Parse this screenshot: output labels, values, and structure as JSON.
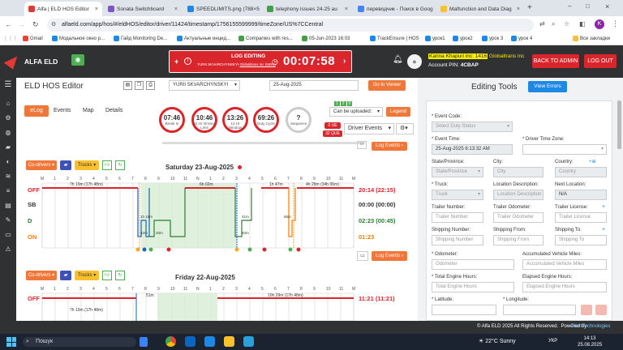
{
  "browser": {
    "tabs": [
      {
        "title": "Alfa | ELD HOS Editor",
        "color": "#e53935"
      },
      {
        "title": "Sonata Switchboard",
        "color": "#7e57c2"
      },
      {
        "title": "SPEEDLIMITS.png (788×5",
        "color": "#1e88e5"
      },
      {
        "title": "telephony issues 24-25 au",
        "color": "#43a047"
      },
      {
        "title": "переводчик - Поиск в Goog",
        "color": "#4285f4"
      },
      {
        "title": "Malfunction and Data Diag",
        "color": "#fbc02d"
      }
    ],
    "url": "alfaeld.com/app/hos/#/eldHOS/editor/driver/11424/timestamp/1756155599999/timeZone/US%7CCentral",
    "bookmarks": [
      "Gmail",
      "Модальное окно р...",
      "Гайд Monitoring De...",
      "Актуальные инцид...",
      "Companies with res...",
      "05-Jun-2023 16:03",
      "TrackEnsure | HOS",
      "урок1",
      "урок2",
      "урок 3",
      "урок 4"
    ],
    "all_bookmarks": "Все закладки"
  },
  "header": {
    "logo": "ALFA ELD",
    "log_editing": "LOG EDITING",
    "log_editing_sub": "YURII SKVARCHYNSKYI",
    "log_editing_link": "Globaltrans inc (5591)",
    "timer": "00:07:58",
    "company_user": "Kanna Khapuri inc: 1416",
    "company_name": "Globaltrans inc",
    "account_pin_label": "Account PIN:",
    "account_pin": "4CBAP",
    "back_to_admin": "BACK TO ADMIN",
    "logout": "LOG OUT"
  },
  "editor": {
    "title": "ELD HOS Editor",
    "driver": "YURII SKVARCHYNSKYI",
    "date": "25-Aug-2025",
    "go_to_viewer": "Go to Viewer",
    "tabs": [
      "eLog",
      "Events",
      "Map",
      "Details"
    ],
    "gauges": [
      {
        "value": "07:46",
        "label": "Break In"
      },
      {
        "value": "10:46",
        "label": "11 Hr Driving Limit"
      },
      {
        "value": "13:26",
        "label": "14 Hr Window"
      },
      {
        "value": "69:26",
        "label": "Duty Cycle"
      },
      {
        "value": "?",
        "label": "Sequence"
      }
    ],
    "can_be_uploaded": "Can be uploaded:",
    "legend": "Legend",
    "badge_0ue": "0 UE",
    "badge_32que": "32 QUE",
    "driver_events": "Driver Events",
    "log_events": "Log Events",
    "co_drivers": "Co-drivers",
    "trucks": "Trucks"
  },
  "day1": {
    "title": "Saturday 23-Aug-2025",
    "rows": [
      {
        "label": "OFF",
        "total": "20:14 (22:15)",
        "color": "#d9262c"
      },
      {
        "label": "SB",
        "total": "00:00 (00:00)",
        "color": "#333333"
      },
      {
        "label": "D",
        "total": "02:23 (00:45)",
        "color": "#2e7d32"
      },
      {
        "label": "ON",
        "total": "01:23",
        "color": "#f57c00"
      }
    ],
    "hours": [
      "M",
      "1",
      "2",
      "3",
      "4",
      "5",
      "6",
      "7",
      "8",
      "9",
      "10",
      "11",
      "N",
      "1",
      "2",
      "3",
      "4",
      "5",
      "6",
      "7",
      "8",
      "9",
      "10",
      "11",
      "M"
    ],
    "segments": {
      "off1": "7h 19m (17h 48m)",
      "off2": "6h 02m",
      "off3": "1h 47m",
      "off4": "4h 29m (34h 06m)",
      "on1": "42m",
      "on2": "20m",
      "on3": "40m",
      "d1": "1h 19m",
      "d2": "41m",
      "d3": "56m"
    }
  },
  "day2": {
    "title": "Friday 22-Aug-2025",
    "off_total": "11:21 (11:21)",
    "off1": "7h 19m (17h 48m)",
    "off2": "51m",
    "off3": "10h 29m (17h 48m)"
  },
  "tools": {
    "title": "Editing Tools",
    "view_errors": "View Errors",
    "fields": {
      "event_code": "* Event Code:",
      "event_code_ph": "Select Duty Status",
      "event_time": "* Event Time:",
      "event_time_val": "25-Aug-2025 6:13:32 AM",
      "driver_tz": "* Driver Time Zone:",
      "state": "State/Province:",
      "state_ph": "State/Province",
      "city": "City:",
      "city_ph": "City",
      "country": "Country:",
      "country_ph": "Country",
      "truck": "* Truck:",
      "truck_ph": "Truck",
      "loc_desc": "Location Description:",
      "loc_desc_ph": "Location Description",
      "next_loc": "Next Location:",
      "next_loc_val": "N/A",
      "trailer_num": "Trailer Number:",
      "trailer_num_ph": "Trailer Number",
      "trailer_odo": "Trailer Odometer:",
      "trailer_odo_ph": "Trailer Odometer",
      "trailer_lic": "Trailer License:",
      "trailer_lic_ph": "Trailer License",
      "ship_num": "Shipping Number:",
      "ship_num_ph": "Shipping Number",
      "ship_from": "Shipping From:",
      "ship_from_ph": "Shipping From",
      "ship_to": "Shipping To:",
      "ship_to_ph": "Shipping To",
      "odometer": "* Odometer:",
      "odometer_ph": "Odometer",
      "acc_miles": "Accumulated Vehicle Miles:",
      "acc_miles_ph": "Accumulated Vehicle Miles",
      "total_hours": "* Total Engine Hours:",
      "total_hours_ph": "Total Engine Hours",
      "elapsed_hours": "Elapsed Engine Hours:",
      "elapsed_hours_ph": "Elapsed Engine Hours",
      "latitude": "* Latitude:",
      "longitude": "* Longitude:"
    }
  },
  "footer": {
    "copyright": "© Alfa ELD  2025 All Rights Reserved.",
    "powered": "Powered by",
    "brand": "TrienTechnologies"
  },
  "taskbar": {
    "search": "Пошук",
    "weather": "22°C  Sunny",
    "lang": "УКР",
    "time": "14:13",
    "date": "25.08.2025"
  }
}
